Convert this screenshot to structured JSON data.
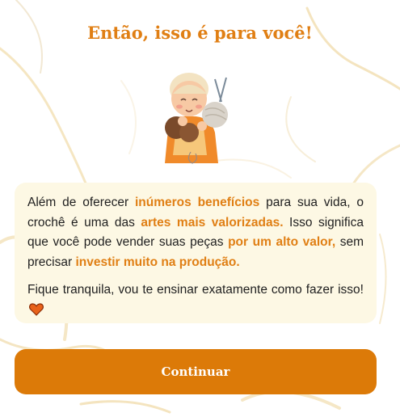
{
  "title": "Então, isso é para você!",
  "card": {
    "p1": [
      {
        "t": "Além de oferecer ",
        "hl": false
      },
      {
        "t": "inúmeros benefícios",
        "hl": true
      },
      {
        "t": " para sua vida, o crochê é uma das ",
        "hl": false
      },
      {
        "t": "artes mais valorizadas.",
        "hl": true
      },
      {
        "t": " Isso significa que você pode vender suas peças ",
        "hl": false
      },
      {
        "t": "por um alto valor,",
        "hl": true
      },
      {
        "t": " sem precisar ",
        "hl": false
      },
      {
        "t": "investir muito na produção.",
        "hl": true
      }
    ],
    "p2": "Fique tranquila, vou te ensinar exatamente como fazer isso!"
  },
  "button": {
    "label": "Continuar"
  },
  "icons": {
    "heart": "heart-icon",
    "illustration": "crochet-grandma-illustration"
  },
  "colors": {
    "accent": "#e07f14",
    "button": "#dc7a08",
    "card_bg": "#fdf8e4",
    "heart": "#e8621a"
  }
}
